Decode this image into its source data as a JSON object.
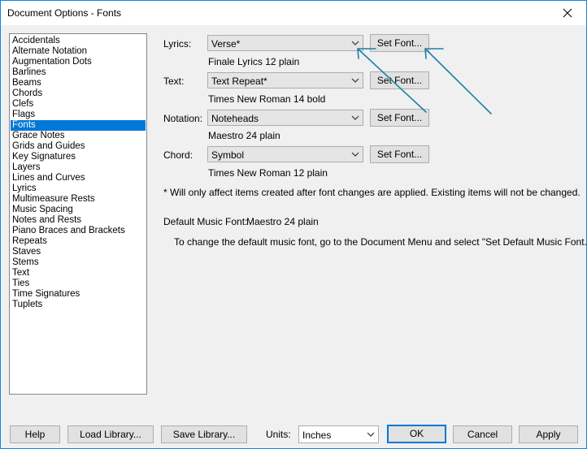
{
  "window": {
    "title": "Document Options - Fonts",
    "close_icon": "close-icon"
  },
  "sidebar": {
    "items": [
      "Accidentals",
      "Alternate Notation",
      "Augmentation Dots",
      "Barlines",
      "Beams",
      "Chords",
      "Clefs",
      "Flags",
      "Fonts",
      "Grace Notes",
      "Grids and Guides",
      "Key Signatures",
      "Layers",
      "Lines and Curves",
      "Lyrics",
      "Multimeasure Rests",
      "Music Spacing",
      "Notes and Rests",
      "Piano Braces and Brackets",
      "Repeats",
      "Staves",
      "Stems",
      "Text",
      "Ties",
      "Time Signatures",
      "Tuplets"
    ],
    "selected": "Fonts"
  },
  "fonts": {
    "lyrics": {
      "label": "Lyrics:",
      "value": "Verse*",
      "button": "Set Font...",
      "description": "Finale Lyrics 12 plain"
    },
    "text": {
      "label": "Text:",
      "value": "Text Repeat*",
      "button": "Set Font...",
      "description": "Times New Roman 14 bold"
    },
    "notation": {
      "label": "Notation:",
      "value": "Noteheads",
      "button": "Set Font...",
      "description": "Maestro 24 plain"
    },
    "chord": {
      "label": "Chord:",
      "value": "Symbol",
      "button": "Set Font...",
      "description": "Times New Roman 12 plain"
    }
  },
  "note": "* Will only affect items created after font changes are applied.  Existing items will not be changed.",
  "default_music_font": {
    "label": "Default Music Font:",
    "value": "Maestro 24 plain",
    "hint": "To change the default music font, go to the Document Menu and select \"Set Default Music Font.\""
  },
  "footer": {
    "help": "Help",
    "load_library": "Load Library...",
    "save_library": "Save Library...",
    "units_label": "Units:",
    "units_value": "Inches",
    "ok": "OK",
    "cancel": "Cancel",
    "apply": "Apply"
  },
  "annotation_color": "#1f7fa6"
}
